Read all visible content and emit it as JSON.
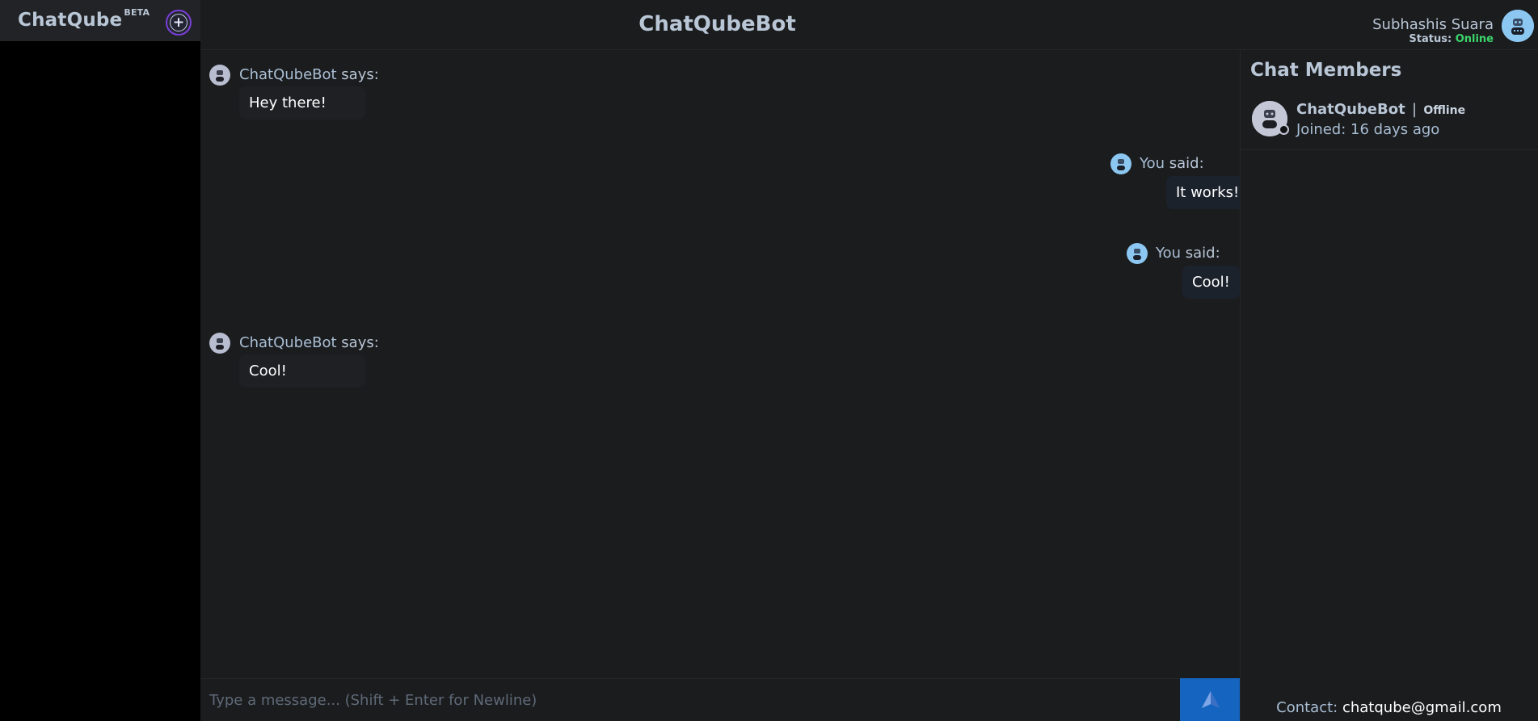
{
  "app": {
    "brand": "ChatQube",
    "brand_tag": "BETA",
    "new_chat_icon": "plus-icon"
  },
  "header": {
    "title": "ChatQubeBot"
  },
  "user": {
    "name": "Subhashis Suara",
    "status_label": "Status:",
    "status_value": "Online",
    "avatar_icon": "robot-avatar-icon"
  },
  "messages": [
    {
      "author": "ChatQubeBot",
      "verb": "says:",
      "text": "Hey there!",
      "mine": false
    },
    {
      "author": "You",
      "verb": "said:",
      "text": "It works!",
      "mine": true
    },
    {
      "author": "You",
      "verb": "said:",
      "text": "Cool!",
      "mine": true
    },
    {
      "author": "ChatQubeBot",
      "verb": "says:",
      "text": "Cool!",
      "mine": false
    }
  ],
  "input": {
    "placeholder": "Type a message... (Shift + Enter for Newline)",
    "value": "",
    "send_icon": "paper-plane-icon"
  },
  "members": {
    "title": "Chat Members",
    "items": [
      {
        "name": "ChatQubeBot",
        "separator": "|",
        "status": "Offline",
        "joined": "Joined: 16 days ago"
      }
    ]
  },
  "contact": {
    "label": "Contact:",
    "email": "chatqube@gmail.com"
  },
  "colors": {
    "accent": "#1565c0",
    "online": "#3bd46b",
    "new_chat_ring": "#7a3fd8"
  }
}
